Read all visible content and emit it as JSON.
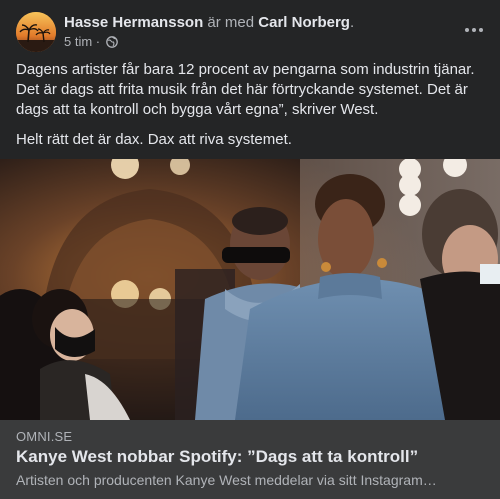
{
  "post": {
    "author": "Hasse Hermansson",
    "with_text": "är med",
    "tagged": "Carl Norberg",
    "period": ".",
    "time": "5 tim",
    "separator": "·",
    "privacy_icon": "globe-icon",
    "menu_icon": "more-horizontal-icon",
    "text_paragraphs": [
      "Dagens artister får bara 12 procent av pengarna som industrin tjänar. Det är dags att frita musik från det här förtryckande systemet. Det är dags att ta kontroll och bygga vårt egna”, skriver West.",
      "Helt rätt det är dax. Dax att riva systemet."
    ]
  },
  "link": {
    "domain": "OMNI.SE",
    "title": "Kanye West nobbar Spotify: ”Dags att ta kontroll”",
    "description": "Artisten och producenten Kanye West meddelar via sitt Instagram…"
  },
  "colors": {
    "background": "#242526",
    "link_box": "#3a3b3c",
    "primary_text": "#e4e6eb",
    "secondary_text": "#b0b3b8"
  }
}
